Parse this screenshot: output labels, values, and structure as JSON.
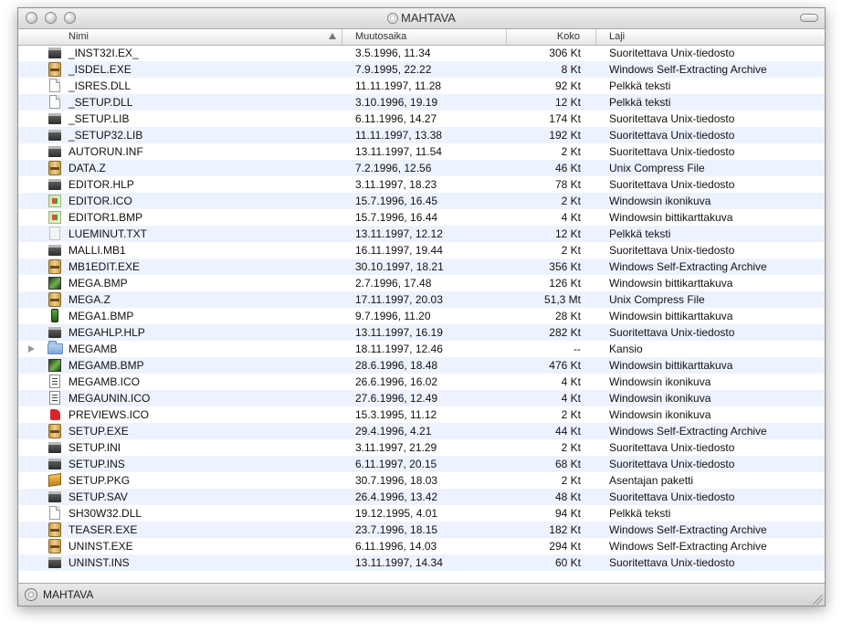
{
  "window": {
    "title": "MAHTAVA"
  },
  "columns": {
    "name": "Nimi",
    "date": "Muutosaika",
    "size": "Koko",
    "kind": "Laji"
  },
  "rows": [
    {
      "name": "_INST32I.EX_",
      "date": "3.5.1996, 11.34",
      "size": "306 Kt",
      "kind": "Suoritettava Unix-tiedosto",
      "icon": "exec"
    },
    {
      "name": "_ISDEL.EXE",
      "date": "7.9.1995, 22.22",
      "size": "8 Kt",
      "kind": "Windows Self-Extracting Archive",
      "icon": "archive"
    },
    {
      "name": "_ISRES.DLL",
      "date": "11.11.1997, 11.28",
      "size": "92 Kt",
      "kind": "Pelkkä teksti",
      "icon": "doc"
    },
    {
      "name": "_SETUP.DLL",
      "date": "3.10.1996, 19.19",
      "size": "12 Kt",
      "kind": "Pelkkä teksti",
      "icon": "doc"
    },
    {
      "name": "_SETUP.LIB",
      "date": "6.11.1996, 14.27",
      "size": "174 Kt",
      "kind": "Suoritettava Unix-tiedosto",
      "icon": "exec"
    },
    {
      "name": "_SETUP32.LIB",
      "date": "11.11.1997, 13.38",
      "size": "192 Kt",
      "kind": "Suoritettava Unix-tiedosto",
      "icon": "exec"
    },
    {
      "name": "AUTORUN.INF",
      "date": "13.11.1997, 11.54",
      "size": "2 Kt",
      "kind": "Suoritettava Unix-tiedosto",
      "icon": "exec"
    },
    {
      "name": "DATA.Z",
      "date": "7.2.1996, 12.56",
      "size": "46 Kt",
      "kind": "Unix Compress File",
      "icon": "archive"
    },
    {
      "name": "EDITOR.HLP",
      "date": "3.11.1997, 18.23",
      "size": "78 Kt",
      "kind": "Suoritettava Unix-tiedosto",
      "icon": "exec"
    },
    {
      "name": "EDITOR.ICO",
      "date": "15.7.1996, 16.45",
      "size": "2 Kt",
      "kind": "Windowsin ikonikuva",
      "icon": "windows"
    },
    {
      "name": "EDITOR1.BMP",
      "date": "15.7.1996, 16.44",
      "size": "4 Kt",
      "kind": "Windowsin bittikarttakuva",
      "icon": "windows"
    },
    {
      "name": "LUEMINUT.TXT",
      "date": "13.11.1997, 12.12",
      "size": "12 Kt",
      "kind": "Pelkkä teksti",
      "icon": "textdoc-faded"
    },
    {
      "name": "MALLI.MB1",
      "date": "16.11.1997, 19.44",
      "size": "2 Kt",
      "kind": "Suoritettava Unix-tiedosto",
      "icon": "exec"
    },
    {
      "name": "MB1EDIT.EXE",
      "date": "30.10.1997, 18.21",
      "size": "356 Kt",
      "kind": "Windows Self-Extracting Archive",
      "icon": "archive"
    },
    {
      "name": "MEGA.BMP",
      "date": "2.7.1996, 17.48",
      "size": "126 Kt",
      "kind": "Windowsin bittikarttakuva",
      "icon": "image"
    },
    {
      "name": "MEGA.Z",
      "date": "17.11.1997, 20.03",
      "size": "51,3 Mt",
      "kind": "Unix Compress File",
      "icon": "archive"
    },
    {
      "name": "MEGA1.BMP",
      "date": "9.7.1996, 11.20",
      "size": "28 Kt",
      "kind": "Windowsin bittikarttakuva",
      "icon": "phone"
    },
    {
      "name": "MEGAHLP.HLP",
      "date": "13.11.1997, 16.19",
      "size": "282 Kt",
      "kind": "Suoritettava Unix-tiedosto",
      "icon": "exec"
    },
    {
      "name": "MEGAMB",
      "date": "18.11.1997, 12.46",
      "size": "--",
      "kind": "Kansio",
      "icon": "folder",
      "folder": true
    },
    {
      "name": "MEGAMB.BMP",
      "date": "28.6.1996, 18.48",
      "size": "476 Kt",
      "kind": "Windowsin bittikarttakuva",
      "icon": "image"
    },
    {
      "name": "MEGAMB.ICO",
      "date": "26.6.1996, 16.02",
      "size": "4 Kt",
      "kind": "Windowsin ikonikuva",
      "icon": "textdoc"
    },
    {
      "name": "MEGAUNIN.ICO",
      "date": "27.6.1996, 12.49",
      "size": "4 Kt",
      "kind": "Windowsin ikonikuva",
      "icon": "textdoc"
    },
    {
      "name": "PREVIEWS.ICO",
      "date": "15.3.1995, 11.12",
      "size": "2 Kt",
      "kind": "Windowsin ikonikuva",
      "icon": "red"
    },
    {
      "name": "SETUP.EXE",
      "date": "29.4.1996, 4.21",
      "size": "44 Kt",
      "kind": "Windows Self-Extracting Archive",
      "icon": "archive"
    },
    {
      "name": "SETUP.INI",
      "date": "3.11.1997, 21.29",
      "size": "2 Kt",
      "kind": "Suoritettava Unix-tiedosto",
      "icon": "exec"
    },
    {
      "name": "SETUP.INS",
      "date": "6.11.1997, 20.15",
      "size": "68 Kt",
      "kind": "Suoritettava Unix-tiedosto",
      "icon": "exec"
    },
    {
      "name": "SETUP.PKG",
      "date": "30.7.1996, 18.03",
      "size": "2 Kt",
      "kind": "Asentajan paketti",
      "icon": "package"
    },
    {
      "name": "SETUP.SAV",
      "date": "26.4.1996, 13.42",
      "size": "48 Kt",
      "kind": "Suoritettava Unix-tiedosto",
      "icon": "exec"
    },
    {
      "name": "SH30W32.DLL",
      "date": "19.12.1995, 4.01",
      "size": "94 Kt",
      "kind": "Pelkkä teksti",
      "icon": "doc"
    },
    {
      "name": "TEASER.EXE",
      "date": "23.7.1996, 18.15",
      "size": "182 Kt",
      "kind": "Windows Self-Extracting Archive",
      "icon": "archive"
    },
    {
      "name": "UNINST.EXE",
      "date": "6.11.1996, 14.03",
      "size": "294 Kt",
      "kind": "Windows Self-Extracting Archive",
      "icon": "archive"
    },
    {
      "name": "UNINST.INS",
      "date": "13.11.1997, 14.34",
      "size": "60 Kt",
      "kind": "Suoritettava Unix-tiedosto",
      "icon": "exec"
    }
  ],
  "status": {
    "volume": "MAHTAVA"
  }
}
